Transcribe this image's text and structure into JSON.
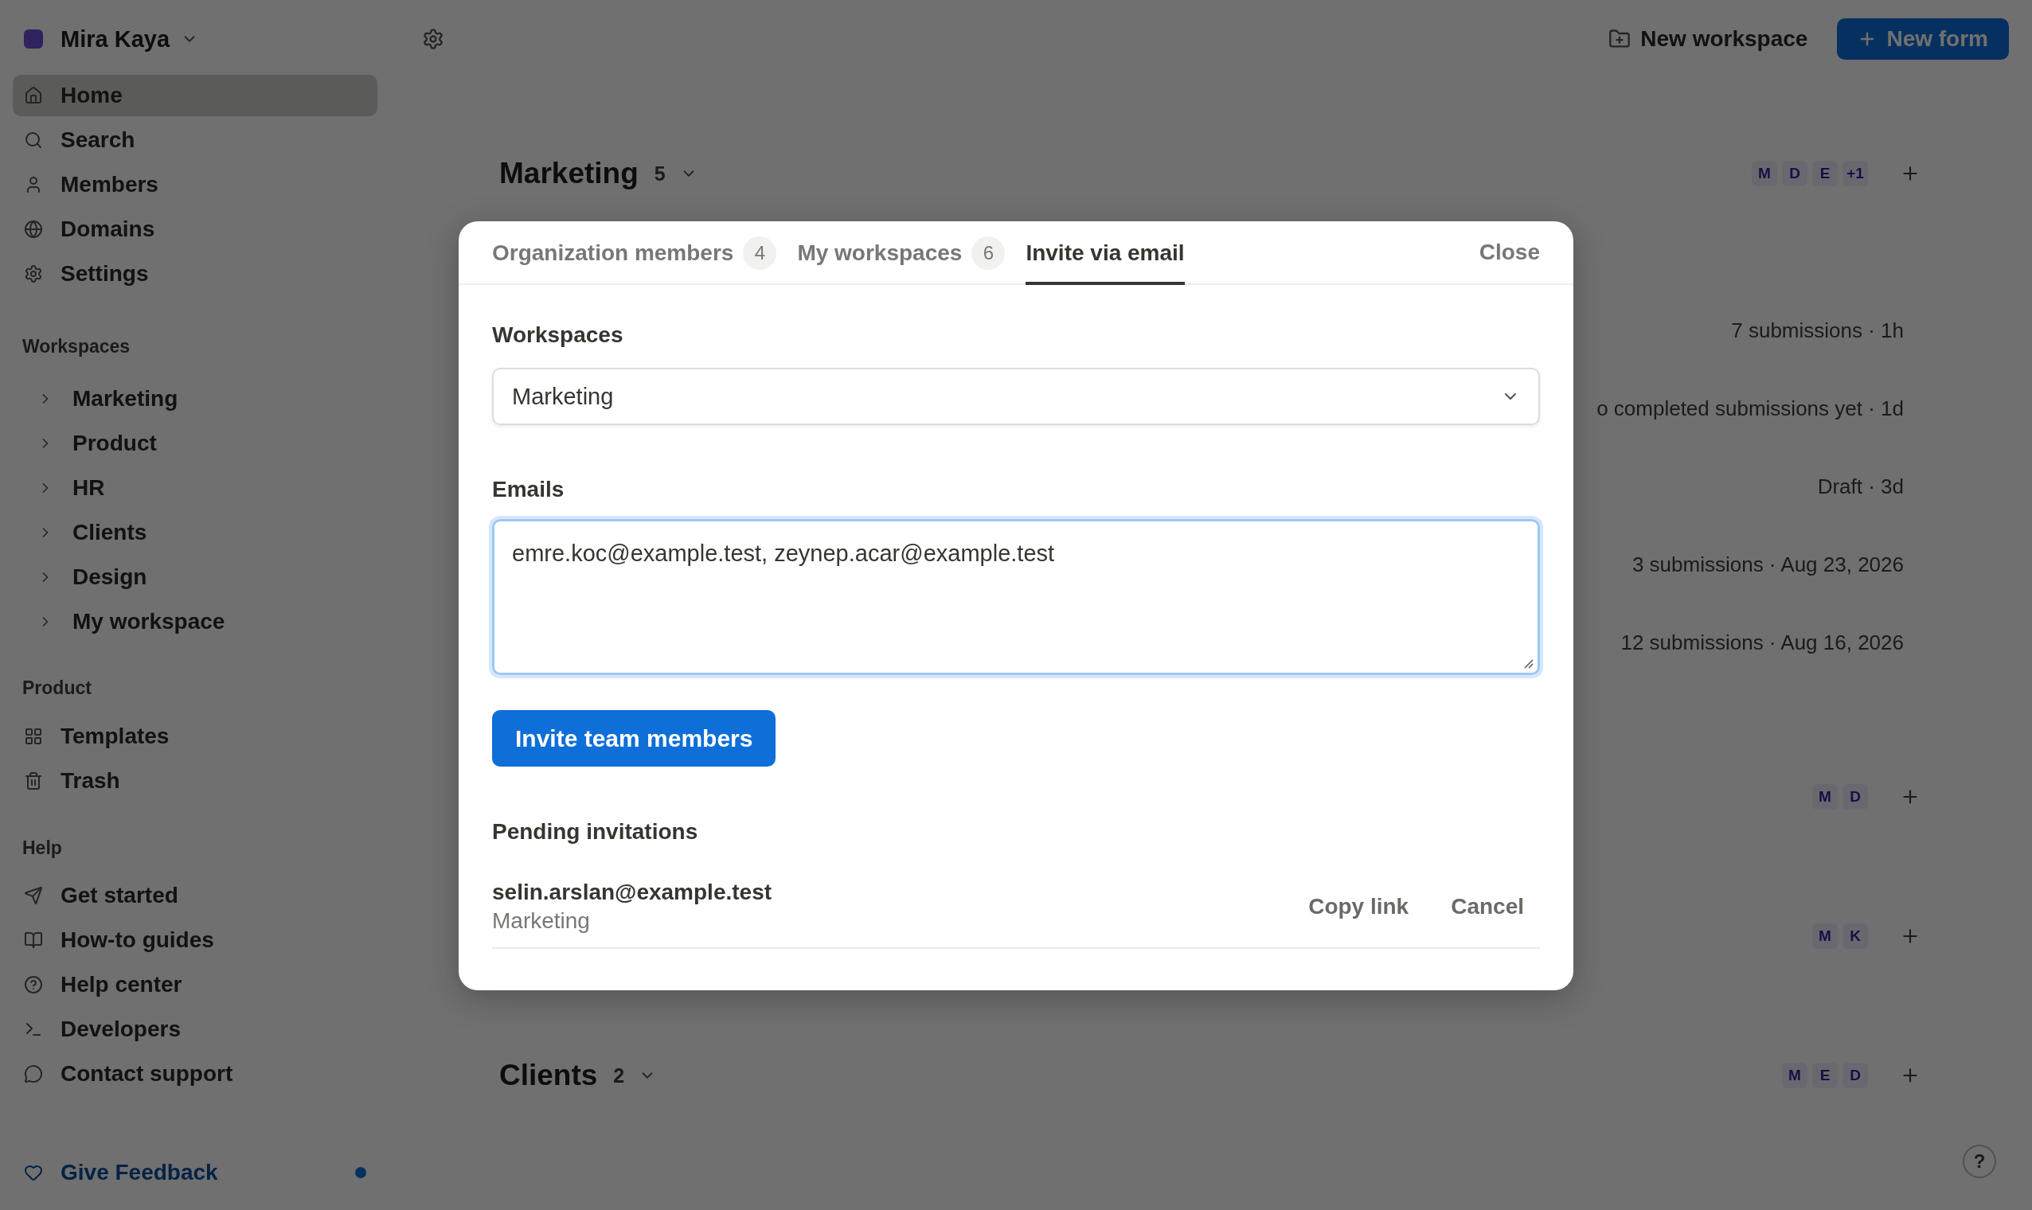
{
  "sidebar": {
    "account": {
      "name": "Mira Kaya"
    },
    "nav": [
      {
        "label": "Home",
        "selected": true
      },
      {
        "label": "Search",
        "selected": false
      },
      {
        "label": "Members",
        "selected": false
      },
      {
        "label": "Domains",
        "selected": false
      },
      {
        "label": "Settings",
        "selected": false
      }
    ],
    "workspaces": {
      "title": "Workspaces",
      "items": [
        "Marketing",
        "Product",
        "HR",
        "Clients",
        "Design",
        "My workspace"
      ]
    },
    "product": {
      "title": "Product",
      "items": [
        "Templates",
        "Trash"
      ]
    },
    "help": {
      "title": "Help",
      "items": [
        "Get started",
        "How-to guides",
        "Help center",
        "Developers",
        "Contact support"
      ]
    },
    "feedback": {
      "label": "Give Feedback",
      "unread": true
    }
  },
  "topbar": {
    "new_workspace": "New workspace",
    "new_form": "New form"
  },
  "main": {
    "sections": [
      {
        "title": "Marketing",
        "count": "5",
        "members": [
          "M",
          "D",
          "E",
          "+1"
        ],
        "rows": [
          "7 submissions · 1h",
          "o completed submissions yet · 1d",
          "Draft · 3d",
          "3 submissions · Aug 23, 2026",
          "12 submissions · Aug 16, 2026"
        ]
      },
      {
        "members": [
          "M",
          "D"
        ]
      },
      {
        "members": [
          "M",
          "K"
        ]
      },
      {
        "title": "Clients",
        "count": "2",
        "members": [
          "M",
          "E",
          "D"
        ]
      }
    ],
    "help_button": "?"
  },
  "dialog": {
    "tabs": [
      {
        "label": "Organization members",
        "count": "4",
        "selected": false
      },
      {
        "label": "My workspaces",
        "count": "6",
        "selected": false
      },
      {
        "label": "Invite via email",
        "selected": true
      }
    ],
    "close": "Close",
    "workspace_field": {
      "label": "Workspaces",
      "value": "Marketing"
    },
    "emails_field": {
      "label": "Emails",
      "value": "emre.koc@example.test, zeynep.acar@example.test",
      "focused": true
    },
    "submit": "Invite team members",
    "pending": {
      "title": "Pending invitations",
      "items": [
        {
          "email": "selin.arslan@example.test",
          "workspace": "Marketing",
          "actions": [
            "Copy link",
            "Cancel"
          ]
        }
      ]
    }
  }
}
